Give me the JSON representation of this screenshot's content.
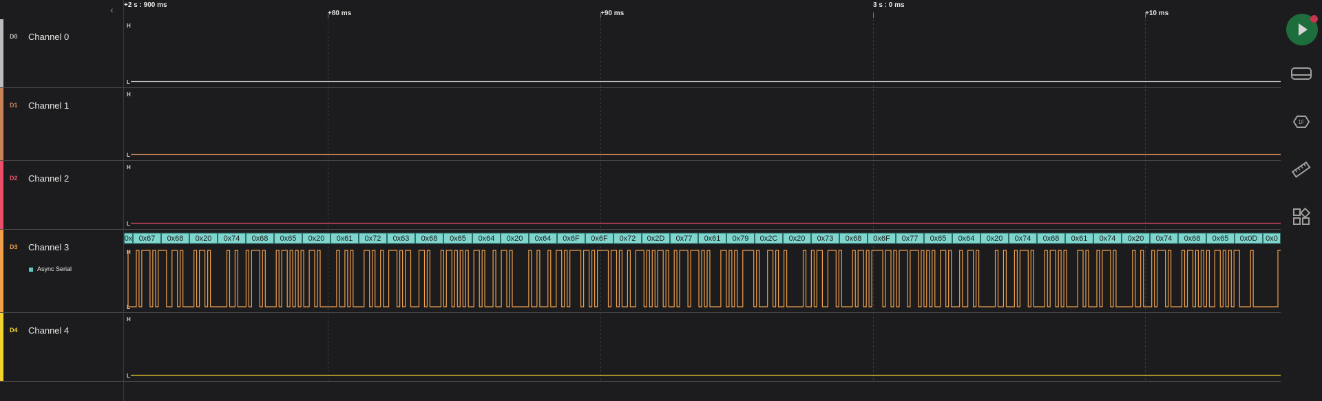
{
  "timeline": {
    "collapse_icon": "chevron-left-icon",
    "labels": [
      {
        "text": "+2 s : 900 ms",
        "row": "top"
      },
      {
        "text": "+80 ms",
        "row": "bottom"
      },
      {
        "text": "+90 ms",
        "row": "bottom"
      },
      {
        "text": "3 s : 0 ms",
        "row": "top"
      },
      {
        "text": "+10 ms",
        "row": "bottom"
      }
    ]
  },
  "channels": [
    {
      "tag": "D0",
      "name": "Channel 0",
      "color": "#bdbdbd",
      "high": "H",
      "low": "L",
      "level": "low"
    },
    {
      "tag": "D1",
      "name": "Channel 1",
      "color": "#c98358",
      "high": "H",
      "low": "L",
      "level": "low"
    },
    {
      "tag": "D2",
      "name": "Channel 2",
      "color": "#ec4f6a",
      "high": "H",
      "low": "L",
      "level": "low"
    },
    {
      "tag": "D3",
      "name": "Channel 3",
      "color": "#f0a04b",
      "high": "H",
      "low": "L",
      "level": "serial",
      "analyzer": "Async Serial",
      "analyzer_color": "#5ec8c1"
    },
    {
      "tag": "D4",
      "name": "Channel 4",
      "color": "#f2d22e",
      "high": "H",
      "low": "L",
      "level": "low"
    }
  ],
  "decoded_bytes": [
    "0x",
    "0x67",
    "0x68",
    "0x20",
    "0x74",
    "0x68",
    "0x65",
    "0x20",
    "0x61",
    "0x72",
    "0x63",
    "0x68",
    "0x65",
    "0x64",
    "0x20",
    "0x64",
    "0x6F",
    "0x6F",
    "0x72",
    "0x2D",
    "0x77",
    "0x61",
    "0x79",
    "0x2C",
    "0x20",
    "0x73",
    "0x68",
    "0x6F",
    "0x77",
    "0x65",
    "0x64",
    "0x20",
    "0x74",
    "0x68",
    "0x61",
    "0x74",
    "0x20",
    "0x74",
    "0x68",
    "0x65",
    "0x0D",
    "0x0"
  ],
  "right_toolbar": {
    "play": {
      "icon": "play-icon",
      "status_color": "#c8354c"
    },
    "buttons": [
      "device-icon",
      "hex-display-icon",
      "measure-ruler-icon",
      "extensions-icon"
    ]
  }
}
